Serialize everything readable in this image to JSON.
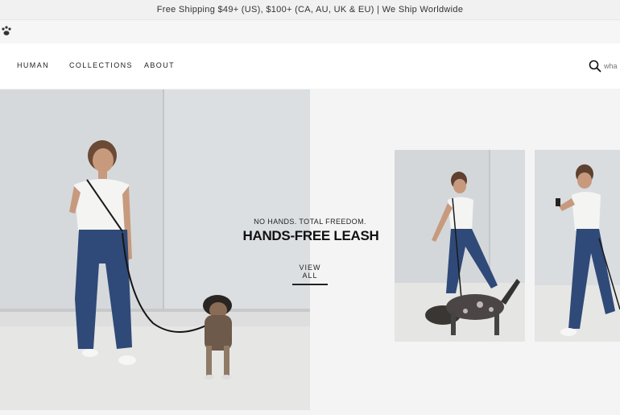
{
  "announcement": {
    "text": "Free Shipping $49+ (US), $100+ (CA, AU, UK & EU) | We Ship Worldwide"
  },
  "logo": {
    "icon": "paw-logo-icon"
  },
  "nav": {
    "items": [
      {
        "label": "HUMAN"
      },
      {
        "label": "COLLECTIONS"
      },
      {
        "label": "ABOUT"
      }
    ],
    "search": {
      "icon": "search-icon",
      "placeholder": "wha"
    }
  },
  "hero": {
    "tagline": "NO HANDS. TOTAL FREEDOM.",
    "headline": "HANDS-FREE LEASH",
    "cta_label": "VIEW ALL"
  },
  "colors": {
    "accent": "#111111",
    "background": "#f4f4f4",
    "jeans": "#2f4a78"
  }
}
